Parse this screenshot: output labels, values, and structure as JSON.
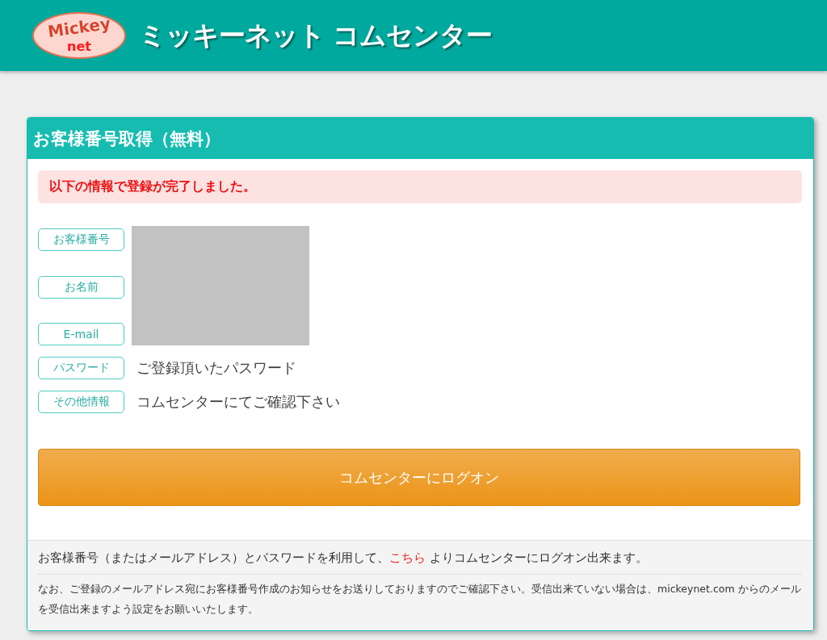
{
  "header": {
    "logo": {
      "top": "Mickey",
      "bottom": "net"
    },
    "title": "ミッキーネット コムセンター"
  },
  "card": {
    "title": "お客様番号取得（無料）",
    "alert": "以下の情報で登録が完了しました。",
    "rows": [
      {
        "label": "お客様番号",
        "kind": "hidden"
      },
      {
        "label": "お名前",
        "kind": "hidden"
      },
      {
        "label": "E-mail",
        "kind": "hidden"
      },
      {
        "label": "パスワード",
        "kind": "text",
        "value": "ご登録頂いたパスワード"
      },
      {
        "label": "その他情報",
        "kind": "text",
        "value": "コムセンターにてご確認下さい"
      }
    ],
    "button": "コムセンターにログオン",
    "footer": {
      "before": "お客様番号（またはメールアドレス）とパスワードを利用して、",
      "link": "こちら",
      "after": " よりコムセンターにログオン出来ます。",
      "note": "なお、ご登録のメールアドレス宛にお客様番号作成のお知らせをお送りしておりますのでご確認下さい。受信出来ていない場合は、mickeynet.com からのメールを受信出来ますよう設定をお願いいたします。"
    }
  }
}
